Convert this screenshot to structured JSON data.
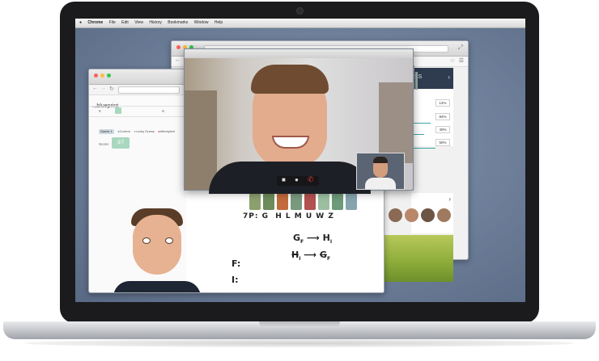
{
  "menubar": {
    "apple": "",
    "items": [
      "Chrome",
      "File",
      "Edit",
      "View",
      "History",
      "Bookmarks",
      "Window",
      "Help"
    ]
  },
  "right_browser": {
    "header_text": "SS",
    "percentages": [
      "14%",
      "84%",
      "40%",
      "50%"
    ]
  },
  "left_browser": {
    "logo_prefix": "my",
    "logo_word": "blueprint",
    "col_a": "¥",
    "col_b": "A",
    "legend": {
      "pill": "Gamer 1",
      "items": [
        "Correct",
        "Lucky Guess",
        "Attempted"
      ]
    },
    "score_label": "Score:",
    "score_value": "3/7"
  },
  "whiteboard": {
    "letters_row": "7P: G  H L M U W Z",
    "line1_left": "G",
    "line1_left_sub": "F",
    "line1_right": "H",
    "line1_right_sub": "I",
    "line2_left": "H",
    "line2_left_sub": "I",
    "line2_right": "G",
    "line2_right_sub": "F",
    "label_f": "F:",
    "label_i": "I:"
  },
  "video_call": {
    "controls": [
      "camera-icon",
      "mic-icon",
      "end-call-icon"
    ]
  },
  "colors": {
    "accent_teal": "#3ca7a5",
    "score_green": "#a9d8bf",
    "navy_panel": "#2f3c50",
    "end_call_red": "#e53935"
  }
}
